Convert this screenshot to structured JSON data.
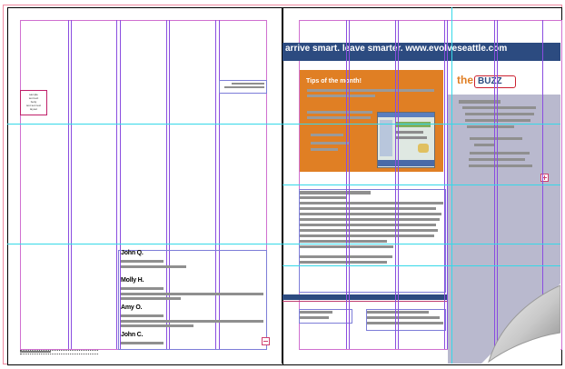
{
  "left_page": {
    "small_box_text": [
      "sample",
      "text text",
      "body",
      "text text text",
      "layout"
    ],
    "people": [
      {
        "name": "John Q."
      },
      {
        "name": "Molly H."
      },
      {
        "name": "Amy O."
      },
      {
        "name": "John C."
      }
    ]
  },
  "right_page": {
    "banner_text": "arrive smart. leave smarter. www.evolveseattle.com",
    "tips_title": "Tips of the month!",
    "buzz_prefix": "the",
    "buzz_word": "BUZZ"
  },
  "colors": {
    "banner": "#2c4b80",
    "tips_panel": "#e07f24",
    "buzz_panel": "#b9b9ce",
    "column_guides": "#8a4de0",
    "horizontal_guides": "#35d8e8",
    "bleed": "#f08aa0"
  },
  "icons": [
    "page-curl-icon",
    "overset-text-icon"
  ]
}
